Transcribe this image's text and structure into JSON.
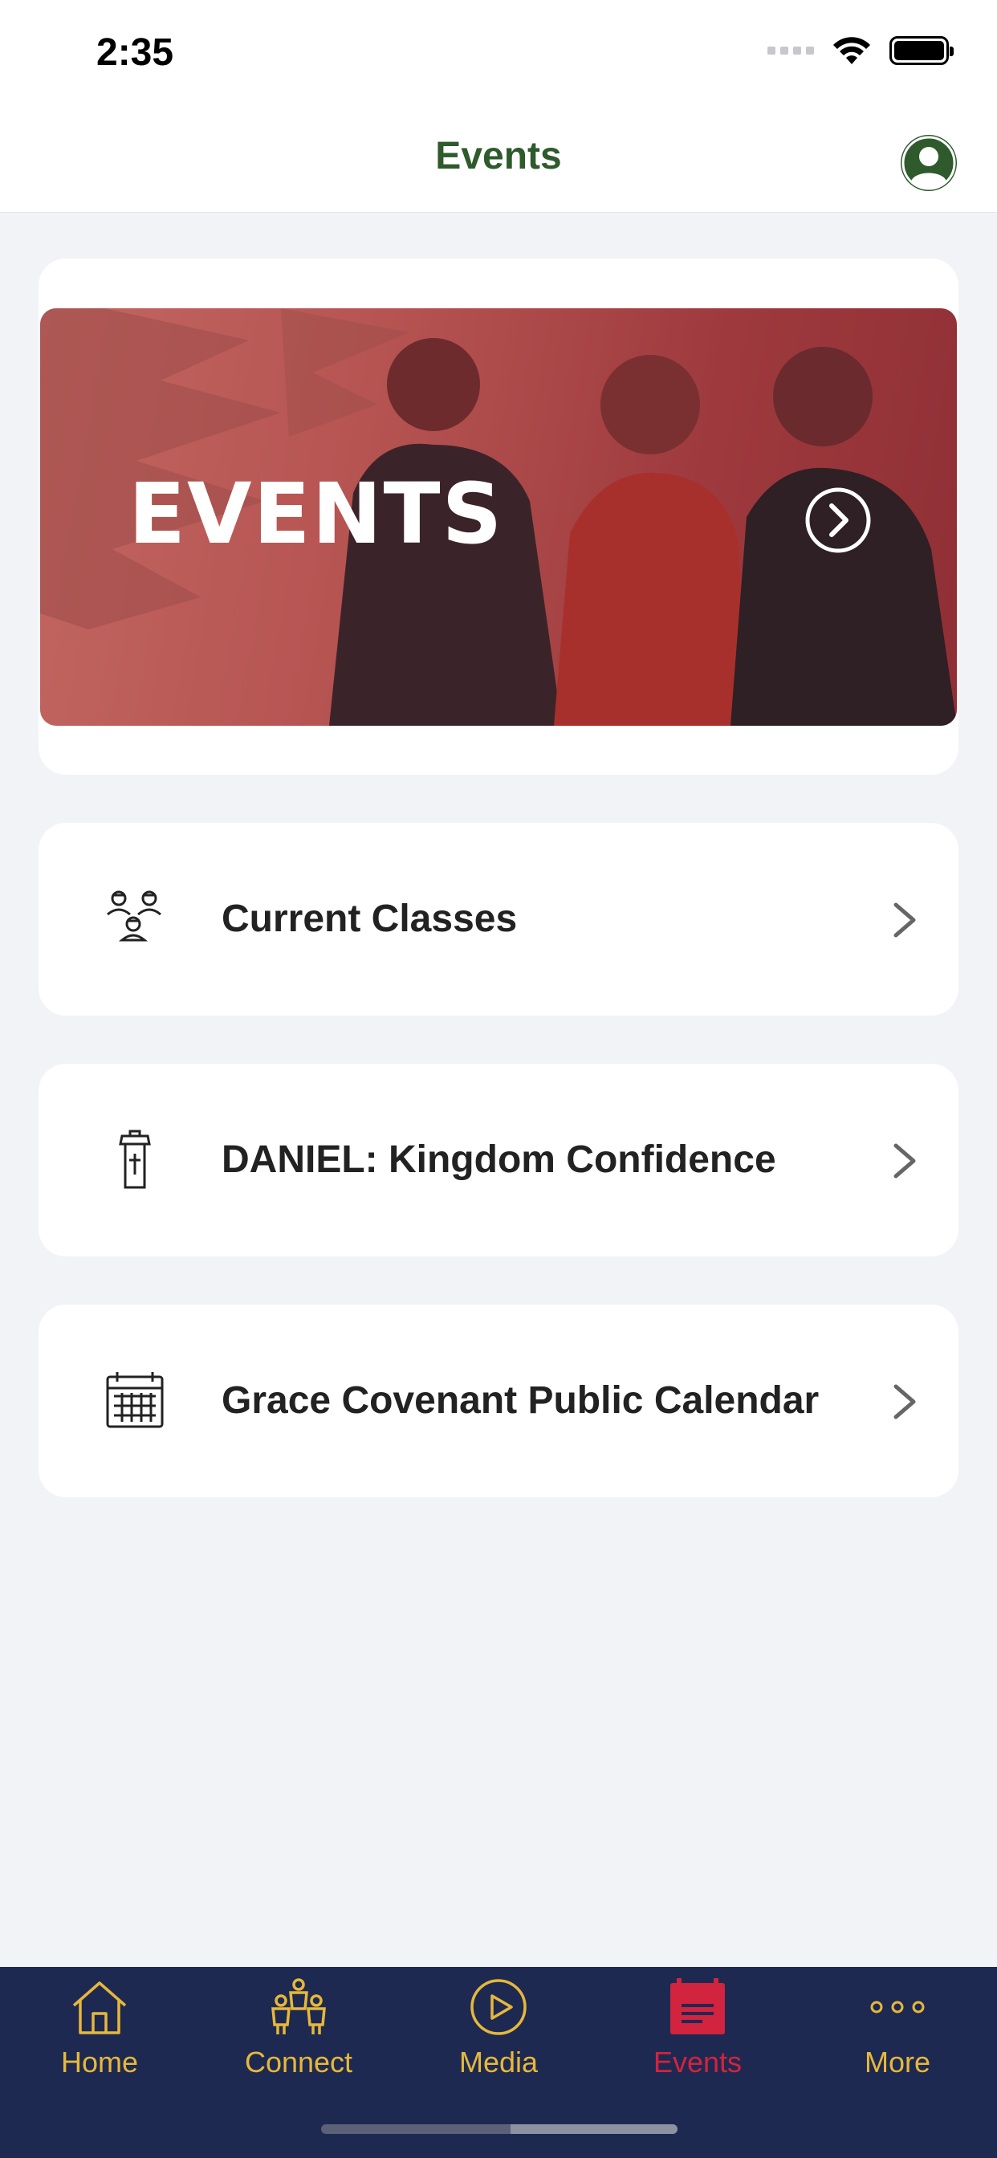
{
  "status_bar": {
    "time": "2:35"
  },
  "header": {
    "title": "Events"
  },
  "banner": {
    "title": "EVENTS"
  },
  "list": [
    {
      "label": "Current Classes",
      "icon": "people-group-icon"
    },
    {
      "label": "DANIEL: Kingdom Confidence",
      "icon": "pulpit-icon"
    },
    {
      "label": "Grace Covenant Public Calendar",
      "icon": "calendar-icon"
    }
  ],
  "tabs": [
    {
      "label": "Home",
      "icon": "home-icon"
    },
    {
      "label": "Connect",
      "icon": "people-icon"
    },
    {
      "label": "Media",
      "icon": "play-icon"
    },
    {
      "label": "Events",
      "icon": "events-icon",
      "active": true
    },
    {
      "label": "More",
      "icon": "more-icon"
    }
  ],
  "colors": {
    "header_title": "#2e5a2c",
    "tab_bar": "#1e2952",
    "tab_inactive": "#e6b83a",
    "tab_active": "#d2233f",
    "banner_overlay": "#b65452"
  }
}
